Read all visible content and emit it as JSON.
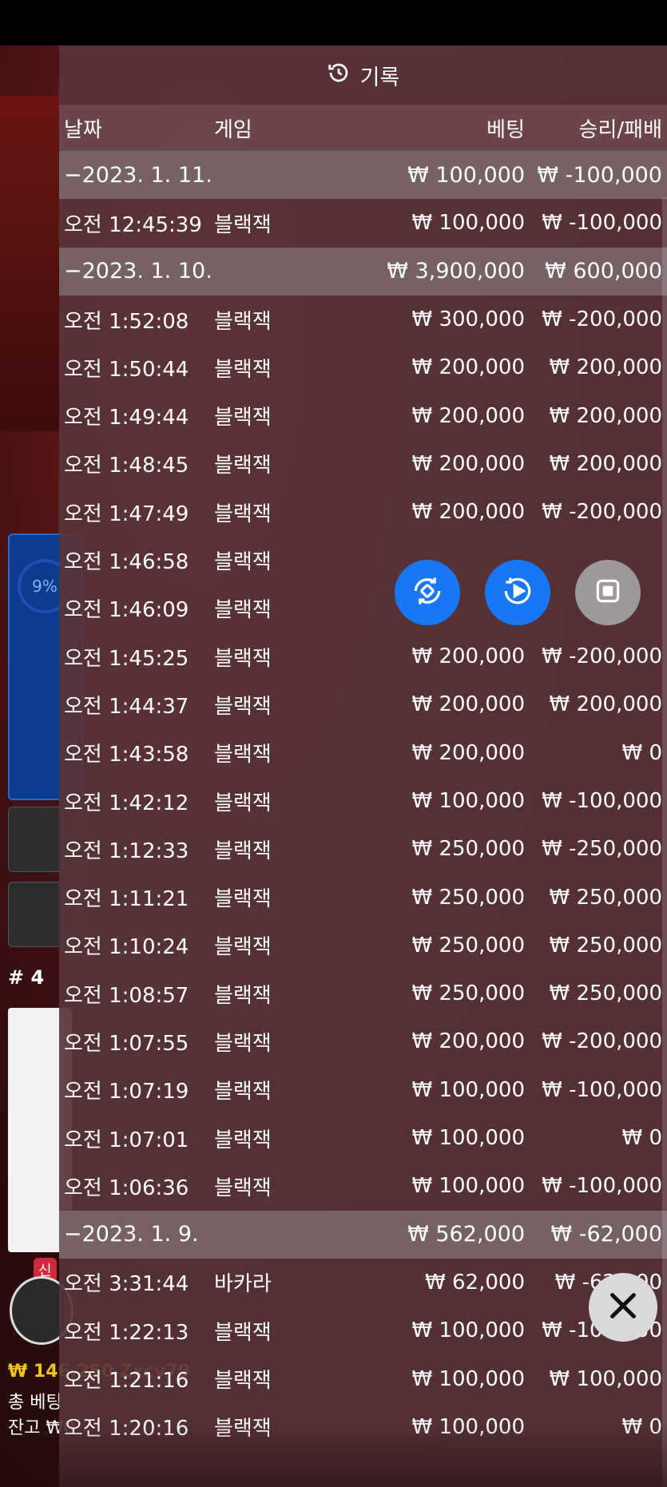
{
  "background": {
    "percent": "9%",
    "table_number": "# 4",
    "new_badge": "신",
    "balance_line": "₩ 146,250 Zxcv79",
    "total_bet_label": "총 베팅",
    "remaining_label": "잔고 ₩0"
  },
  "header": {
    "title": "기록",
    "icon": "history-icon"
  },
  "columns": {
    "date": "날짜",
    "game": "게임",
    "bet": "베팅",
    "result": "승리/패배"
  },
  "rows": [
    {
      "type": "date",
      "time": "−2023. 1. 11.",
      "game": "",
      "bet": "₩ 100,000",
      "result": "₩ -100,000"
    },
    {
      "type": "entry",
      "time": "오전 12:45:39",
      "game": "블랙잭",
      "bet": "₩ 100,000",
      "result": "₩ -100,000"
    },
    {
      "type": "date",
      "time": "−2023. 1. 10.",
      "game": "",
      "bet": "₩ 3,900,000",
      "result": "₩ 600,000"
    },
    {
      "type": "entry",
      "time": "오전 1:52:08",
      "game": "블랙잭",
      "bet": "₩ 300,000",
      "result": "₩ -200,000"
    },
    {
      "type": "entry",
      "time": "오전 1:50:44",
      "game": "블랙잭",
      "bet": "₩ 200,000",
      "result": "₩ 200,000"
    },
    {
      "type": "entry",
      "time": "오전 1:49:44",
      "game": "블랙잭",
      "bet": "₩ 200,000",
      "result": "₩ 200,000"
    },
    {
      "type": "entry",
      "time": "오전 1:48:45",
      "game": "블랙잭",
      "bet": "₩ 200,000",
      "result": "₩ 200,000"
    },
    {
      "type": "entry",
      "time": "오전 1:47:49",
      "game": "블랙잭",
      "bet": "₩ 200,000",
      "result": "₩ -200,000"
    },
    {
      "type": "entry",
      "time": "오전 1:46:58",
      "game": "블랙잭",
      "bet": "",
      "result": ""
    },
    {
      "type": "entry",
      "time": "오전 1:46:09",
      "game": "블랙잭",
      "bet": "",
      "result": ""
    },
    {
      "type": "entry",
      "time": "오전 1:45:25",
      "game": "블랙잭",
      "bet": "₩ 200,000",
      "result": "₩ -200,000"
    },
    {
      "type": "entry",
      "time": "오전 1:44:37",
      "game": "블랙잭",
      "bet": "₩ 200,000",
      "result": "₩ 200,000"
    },
    {
      "type": "entry",
      "time": "오전 1:43:58",
      "game": "블랙잭",
      "bet": "₩ 200,000",
      "result": "₩ 0"
    },
    {
      "type": "entry",
      "time": "오전 1:42:12",
      "game": "블랙잭",
      "bet": "₩ 100,000",
      "result": "₩ -100,000"
    },
    {
      "type": "entry",
      "time": "오전 1:12:33",
      "game": "블랙잭",
      "bet": "₩ 250,000",
      "result": "₩ -250,000"
    },
    {
      "type": "entry",
      "time": "오전 1:11:21",
      "game": "블랙잭",
      "bet": "₩ 250,000",
      "result": "₩ 250,000"
    },
    {
      "type": "entry",
      "time": "오전 1:10:24",
      "game": "블랙잭",
      "bet": "₩ 250,000",
      "result": "₩ 250,000"
    },
    {
      "type": "entry",
      "time": "오전 1:08:57",
      "game": "블랙잭",
      "bet": "₩ 250,000",
      "result": "₩ 250,000"
    },
    {
      "type": "entry",
      "time": "오전 1:07:55",
      "game": "블랙잭",
      "bet": "₩ 200,000",
      "result": "₩ -200,000"
    },
    {
      "type": "entry",
      "time": "오전 1:07:19",
      "game": "블랙잭",
      "bet": "₩ 100,000",
      "result": "₩ -100,000"
    },
    {
      "type": "entry",
      "time": "오전 1:07:01",
      "game": "블랙잭",
      "bet": "₩ 100,000",
      "result": "₩ 0"
    },
    {
      "type": "entry",
      "time": "오전 1:06:36",
      "game": "블랙잭",
      "bet": "₩ 100,000",
      "result": "₩ -100,000"
    },
    {
      "type": "date",
      "time": "−2023. 1. 9.",
      "game": "",
      "bet": "₩ 562,000",
      "result": "₩ -62,000"
    },
    {
      "type": "entry",
      "time": "오전 3:31:44",
      "game": "바카라",
      "bet": "₩ 62,000",
      "result": "₩ -62,000"
    },
    {
      "type": "entry",
      "time": "오전 1:22:13",
      "game": "블랙잭",
      "bet": "₩ 100,000",
      "result": "₩ -100,000"
    },
    {
      "type": "entry",
      "time": "오전 1:21:16",
      "game": "블랙잭",
      "bet": "₩ 100,000",
      "result": "₩ 100,000"
    },
    {
      "type": "entry",
      "time": "오전 1:20:16",
      "game": "블랙잭",
      "bet": "₩ 100,000",
      "result": "₩ 0"
    }
  ],
  "floating_buttons": [
    {
      "name": "rotate-screen-button",
      "icon": "rotate-icon",
      "color": "#1877f2"
    },
    {
      "name": "autoplay-button",
      "icon": "play-circle-icon",
      "color": "#1877f2"
    },
    {
      "name": "stop-button",
      "icon": "stop-icon",
      "color": "#aaaaaa"
    }
  ],
  "close": {
    "icon": "close-icon"
  }
}
